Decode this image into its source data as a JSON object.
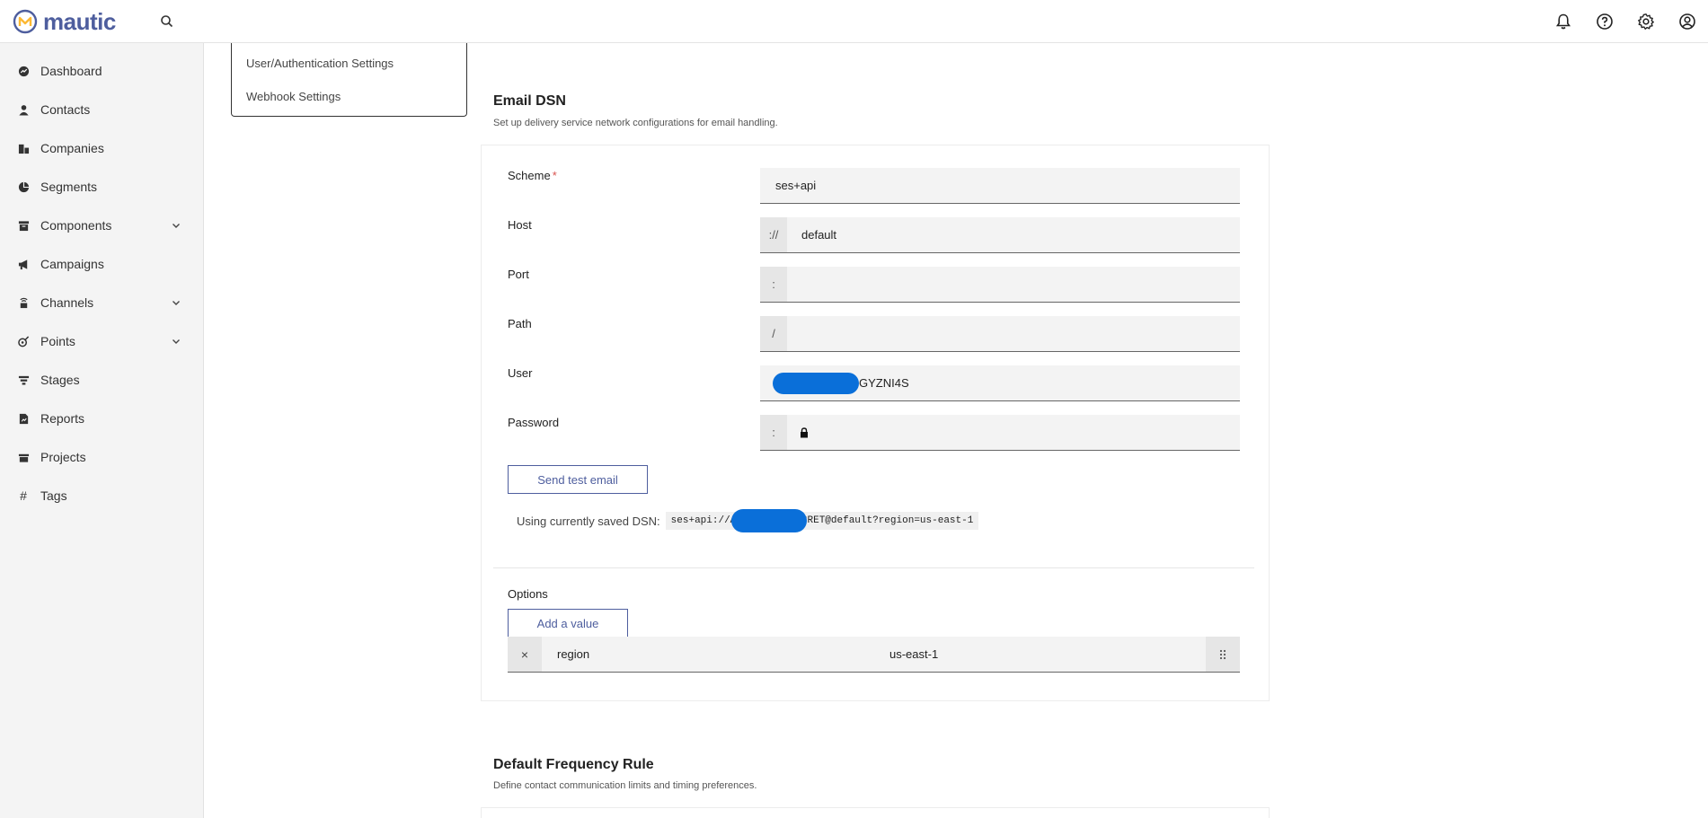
{
  "app": {
    "name": "mautic"
  },
  "header": {
    "icons": [
      "bell-icon",
      "help-icon",
      "gear-icon",
      "user-circle-icon"
    ]
  },
  "sidebar": {
    "items": [
      {
        "label": "Dashboard",
        "icon": "dashboard-icon",
        "has_children": false
      },
      {
        "label": "Contacts",
        "icon": "person-icon",
        "has_children": false
      },
      {
        "label": "Companies",
        "icon": "building-icon",
        "has_children": false
      },
      {
        "label": "Segments",
        "icon": "pie-icon",
        "has_children": false
      },
      {
        "label": "Components",
        "icon": "box-icon",
        "has_children": true
      },
      {
        "label": "Campaigns",
        "icon": "megaphone-icon",
        "has_children": false
      },
      {
        "label": "Channels",
        "icon": "broadcast-icon",
        "has_children": true
      },
      {
        "label": "Points",
        "icon": "points-icon",
        "has_children": true
      },
      {
        "label": "Stages",
        "icon": "filter-icon",
        "has_children": false
      },
      {
        "label": "Reports",
        "icon": "report-icon",
        "has_children": false
      },
      {
        "label": "Projects",
        "icon": "folder-icon",
        "has_children": false
      },
      {
        "label": "Tags",
        "icon": "hash-icon",
        "has_children": false
      }
    ]
  },
  "settings_menu": {
    "items": [
      "User/Authentication Settings",
      "Webhook Settings"
    ]
  },
  "email_dsn": {
    "title": "Email DSN",
    "description": "Set up delivery service network configurations for email handling.",
    "fields": {
      "scheme": {
        "label": "Scheme",
        "required_mark": "*",
        "value": "ses+api"
      },
      "host": {
        "label": "Host",
        "prefix": "://",
        "value": "default"
      },
      "port": {
        "label": "Port",
        "prefix": ":",
        "value": ""
      },
      "path": {
        "label": "Path",
        "prefix": "/",
        "value": ""
      },
      "user": {
        "label": "User",
        "value": "GYZNI4S"
      },
      "password": {
        "label": "Password",
        "prefix": ":",
        "icon": "lock-icon"
      }
    },
    "send_test_label": "Send test email",
    "saved_dsn_label": "Using currently saved DSN:",
    "saved_dsn_value": "ses+api://AK            YZNI4S:SECRET@default?region=us-east-1",
    "options": {
      "label": "Options",
      "add_label": "Add a value",
      "rows": [
        {
          "remove": "×",
          "key": "region",
          "value": "us-east-1"
        }
      ]
    }
  },
  "frequency": {
    "title": "Default Frequency Rule",
    "description": "Define contact communication limits and timing preferences."
  },
  "colors": {
    "brand": "#4e5e9e",
    "accent_orange": "#fdb933",
    "required": "#d9534f",
    "redaction": "#0a6fd9"
  }
}
